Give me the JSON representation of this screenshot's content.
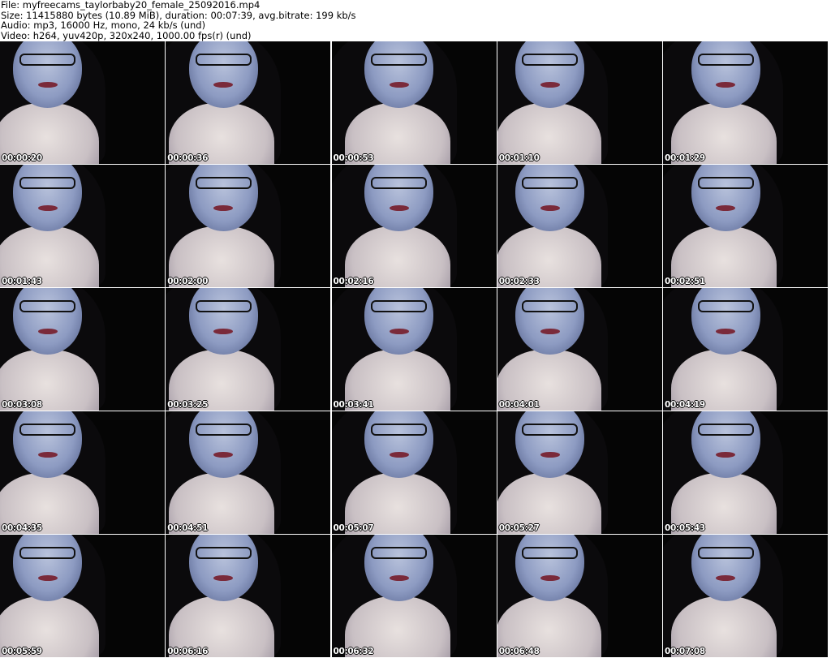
{
  "header": {
    "file_line": "File: myfreecams_taylorbaby20_female_25092016.mp4",
    "size_line": "Size: 11415880 bytes (10.89 MiB), duration: 00:07:39, avg.bitrate: 199 kb/s",
    "audio_line": "Audio: mp3, 16000 Hz, mono, 24 kb/s (und)",
    "video_line": "Video: h264, yuv420p, 320x240, 1000.00 fps(r) (und)"
  },
  "thumbnails": [
    "00:00:20",
    "00:00:36",
    "00:00:53",
    "00:01:10",
    "00:01:29",
    "00:01:43",
    "00:02:00",
    "00:02:16",
    "00:02:33",
    "00:02:51",
    "00:03:08",
    "00:03:25",
    "00:03:41",
    "00:04:01",
    "00:04:19",
    "00:04:35",
    "00:04:51",
    "00:05:07",
    "00:05:27",
    "00:05:43",
    "00:05:59",
    "00:06:16",
    "00:06:32",
    "00:06:48",
    "00:07:08"
  ]
}
